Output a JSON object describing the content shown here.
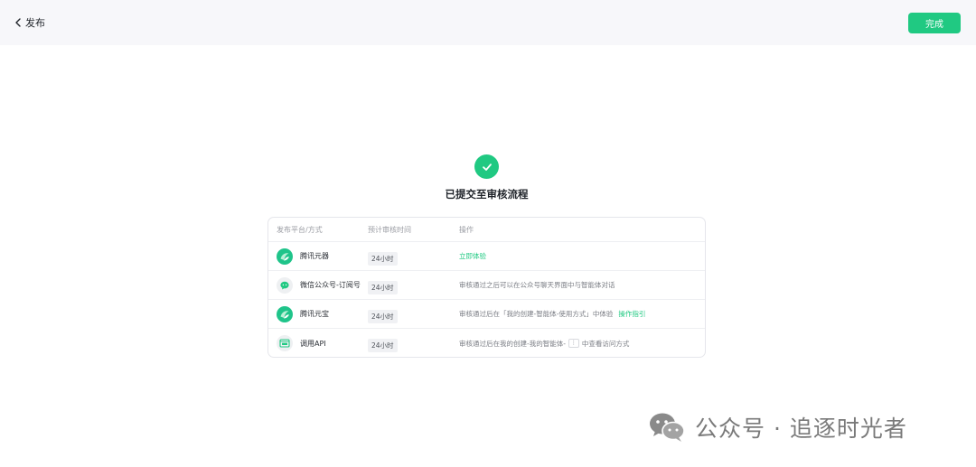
{
  "header": {
    "back_label": "发布",
    "done_label": "完成"
  },
  "status": {
    "title": "已提交至审核流程"
  },
  "table": {
    "headers": {
      "platform": "发布平台/方式",
      "time": "预计审核时间",
      "action": "操作"
    },
    "rows": [
      {
        "icon": "yuanqi-logo-icon",
        "name": "腾讯元器",
        "time": "24小时",
        "action_link": "立即体验"
      },
      {
        "icon": "wechat-icon",
        "name": "微信公众号-订阅号",
        "time": "24小时",
        "action_text": "审核通过之后可以在公众号聊天界面中与智能体对话"
      },
      {
        "icon": "yuanbao-logo-icon",
        "name": "腾讯元宝",
        "time": "24小时",
        "action_text": "审核通过后在「我的创建-智能体-使用方式」中体验",
        "action_link": "操作指引"
      },
      {
        "icon": "api-icon",
        "name": "调用API",
        "time": "24小时",
        "action_text_before": "审核通过后在我的创建-我的智能体-",
        "action_kbd": "⋮",
        "action_text_after": "中查看访问方式"
      }
    ]
  },
  "watermark": {
    "text": "公众号 · 追逐时光者"
  },
  "colors": {
    "accent": "#20c982",
    "topbar_bg": "#f7f7fa"
  }
}
